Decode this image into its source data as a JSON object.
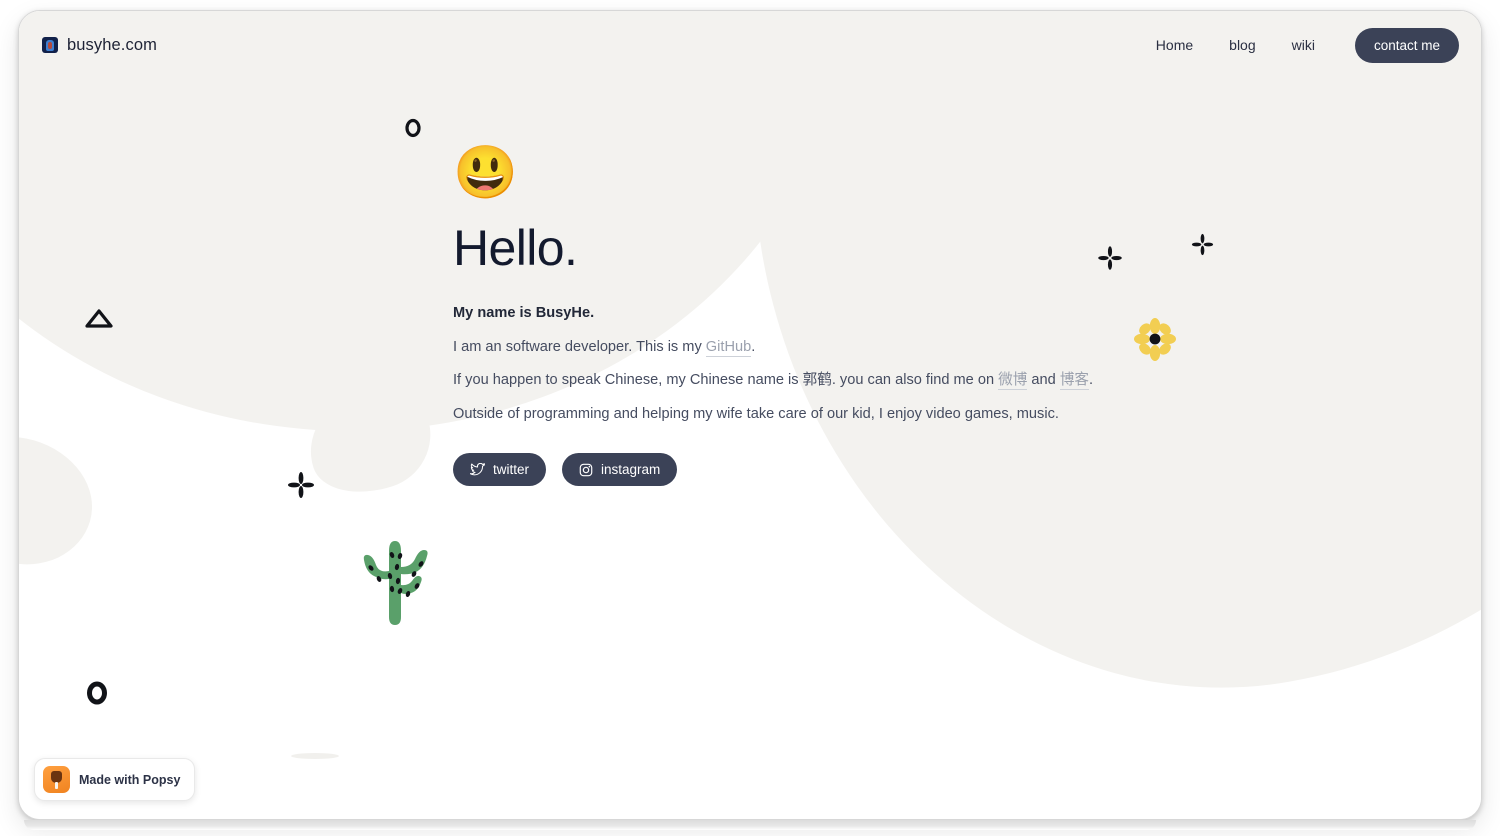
{
  "site": {
    "brand_name": "busyhe.com",
    "favicon_name": "site-favicon"
  },
  "nav": {
    "links": [
      {
        "label": "Home",
        "name": "nav-link-home"
      },
      {
        "label": "blog",
        "name": "nav-link-blog"
      },
      {
        "label": "wiki",
        "name": "nav-link-wiki"
      }
    ],
    "cta_label": "contact me"
  },
  "hero": {
    "emoji": "😃",
    "title": "Hello.",
    "lines": {
      "l1": "My name is BusyHe.",
      "l2_a": "I am an software developer. This is my ",
      "l2_link": "GitHub",
      "l2_b": ".",
      "l3_a": "If you happen to speak Chinese, my Chinese name is 郭鹤. you can also find me on ",
      "l3_link1": "微博",
      "l3_b": " and ",
      "l3_link2": "博客",
      "l3_c": ".",
      "l4": "Outside of programming and helping my wife take care of our kid, I enjoy video games, music."
    }
  },
  "social": {
    "twitter_label": "twitter",
    "instagram_label": "instagram"
  },
  "footer": {
    "popsy_label": "Made with Popsy"
  },
  "colors": {
    "dark_navy": "#3b4257",
    "heading": "#131a2e",
    "body_text": "#454c60",
    "link_gray": "#9aa0ad",
    "blob_gray": "#f3f2ef",
    "cactus_green": "#5aa06a",
    "flower_yellow": "#f2ce52",
    "popsy_orange": "#f08320",
    "page_bg": "#ffffff"
  }
}
